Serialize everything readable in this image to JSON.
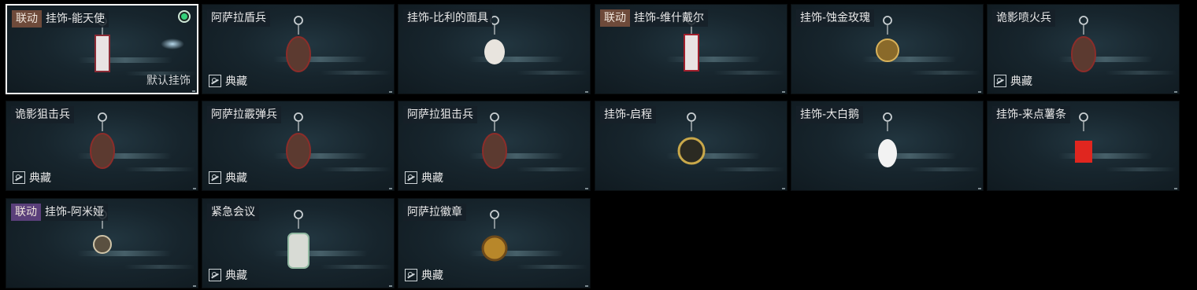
{
  "default_label": "默认挂饰",
  "rarity_label": "典藏",
  "cards": [
    {
      "badge": "联动",
      "badge_color": "#6e4a3a",
      "name": "挂饰-能天使",
      "rarity": false,
      "selected": true,
      "default": true,
      "icon": "angel-charm-icon"
    },
    {
      "badge": "",
      "name": "阿萨拉盾兵",
      "rarity": true,
      "icon": "shield-soldier-charm-icon"
    },
    {
      "badge": "",
      "name": "挂饰-比利的面具",
      "rarity": false,
      "icon": "billy-mask-charm-icon"
    },
    {
      "badge": "联动",
      "badge_color": "#6e4a3a",
      "name": "挂饰-维什戴尔",
      "rarity": false,
      "icon": "wisadel-charm-icon"
    },
    {
      "badge": "",
      "name": "挂饰-蚀金玫瑰",
      "rarity": false,
      "icon": "gold-rose-charm-icon"
    },
    {
      "badge": "",
      "name": "诡影喷火兵",
      "rarity": true,
      "icon": "flamethrower-charm-icon"
    },
    {
      "badge": "",
      "name": "诡影狙击兵",
      "rarity": true,
      "icon": "sniper-charm-icon"
    },
    {
      "badge": "",
      "name": "阿萨拉霰弹兵",
      "rarity": true,
      "icon": "shotgunner-charm-icon"
    },
    {
      "badge": "",
      "name": "阿萨拉狙击兵",
      "rarity": true,
      "icon": "asara-sniper-charm-icon"
    },
    {
      "badge": "",
      "name": "挂饰-启程",
      "rarity": false,
      "icon": "departure-medal-charm-icon"
    },
    {
      "badge": "",
      "name": "挂饰-大白鹅",
      "rarity": false,
      "icon": "white-goose-charm-icon"
    },
    {
      "badge": "",
      "name": "挂饰-来点薯条",
      "rarity": false,
      "icon": "fries-charm-icon"
    },
    {
      "badge": "联动",
      "badge_color": "#5a3f7a",
      "name": "挂饰-阿米娅",
      "rarity": false,
      "icon": "amiya-charm-icon"
    },
    {
      "badge": "",
      "name": "紧急会议",
      "rarity": true,
      "icon": "emergency-meeting-charm-icon"
    },
    {
      "badge": "",
      "name": "阿萨拉徽章",
      "rarity": true,
      "icon": "asara-emblem-charm-icon"
    }
  ]
}
